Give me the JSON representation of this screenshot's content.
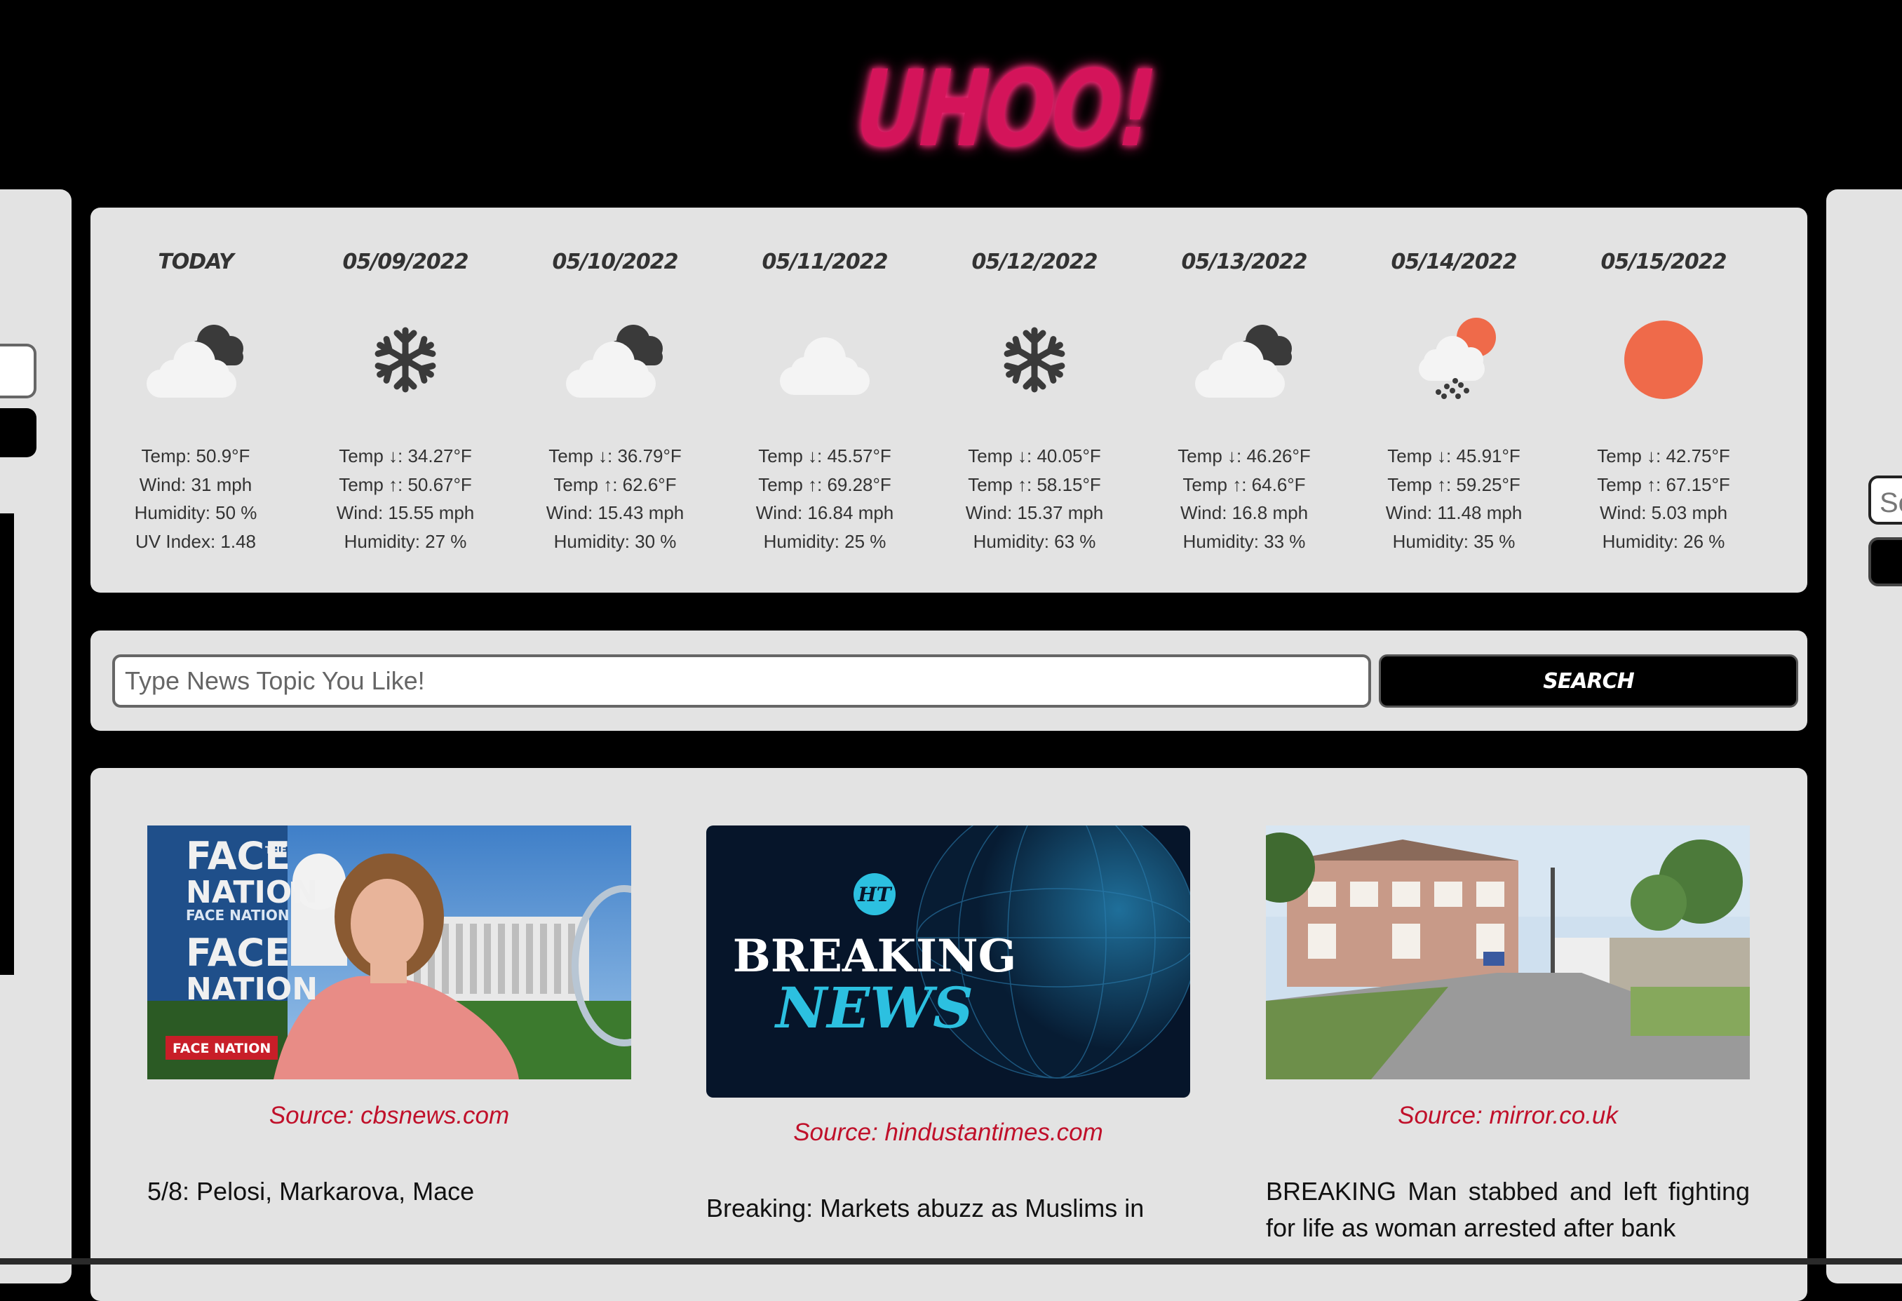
{
  "app": {
    "logo": "UHOO!"
  },
  "weather": {
    "days": [
      {
        "title": "TODAY",
        "icon": "partly-cloudy-icon",
        "lines": [
          "Temp: 50.9°F",
          "Wind: 31 mph",
          "Humidity: 50 %",
          "UV Index: 1.48"
        ]
      },
      {
        "title": "05/09/2022",
        "icon": "snow-icon",
        "lines": [
          "Temp ↓: 34.27°F",
          "Temp ↑: 50.67°F",
          "Wind: 15.55 mph",
          "Humidity: 27 %"
        ]
      },
      {
        "title": "05/10/2022",
        "icon": "partly-cloudy-icon",
        "lines": [
          "Temp ↓: 36.79°F",
          "Temp ↑: 62.6°F",
          "Wind: 15.43 mph",
          "Humidity: 30 %"
        ]
      },
      {
        "title": "05/11/2022",
        "icon": "cloud-icon",
        "lines": [
          "Temp ↓: 45.57°F",
          "Temp ↑: 69.28°F",
          "Wind: 16.84 mph",
          "Humidity: 25 %"
        ]
      },
      {
        "title": "05/12/2022",
        "icon": "snow-icon",
        "lines": [
          "Temp ↓: 40.05°F",
          "Temp ↑: 58.15°F",
          "Wind: 15.37 mph",
          "Humidity: 63 %"
        ]
      },
      {
        "title": "05/13/2022",
        "icon": "partly-cloudy-icon",
        "lines": [
          "Temp ↓: 46.26°F",
          "Temp ↑: 64.6°F",
          "Wind: 16.8 mph",
          "Humidity: 33 %"
        ]
      },
      {
        "title": "05/14/2022",
        "icon": "sun-rain-icon",
        "lines": [
          "Temp ↓: 45.91°F",
          "Temp ↑: 59.25°F",
          "Wind: 11.48 mph",
          "Humidity: 35 %"
        ]
      },
      {
        "title": "05/15/2022",
        "icon": "sun-icon",
        "lines": [
          "Temp ↓: 42.75°F",
          "Temp ↑: 67.15°F",
          "Wind: 5.03 mph",
          "Humidity: 26 %"
        ]
      }
    ]
  },
  "search": {
    "placeholder": "Type News Topic You Like!",
    "button_label": "SEARCH"
  },
  "side_right": {
    "search_placeholder_fragment": "Se"
  },
  "news": {
    "cards": [
      {
        "source": "Source: cbsnews.com",
        "text": "5/8: Pelosi, Markarova, Mace",
        "image": "face-the-nation-image",
        "image_text": {
          "line1": "FACE",
          "line2": "NATION",
          "line3": "FACE",
          "line4": "NATION",
          "the": "THE",
          "sub": "FACE NATION",
          "badge": "FACE NATION"
        }
      },
      {
        "source": "Source: hindustantimes.com",
        "text": "Breaking: Markets abuzz as Muslims in",
        "image": "breaking-news-image",
        "image_text": {
          "logo": "HT",
          "line1": "BREAKING",
          "line2": "NEWS"
        }
      },
      {
        "source": "Source: mirror.co.uk",
        "text": "BREAKING Man stabbed and left fighting for life as woman arrested after bank",
        "image": "street-view-image"
      }
    ]
  },
  "colors": {
    "accent": "#d4145a",
    "panel": "#e3e3e3",
    "source": "#c0102a",
    "sun": "#ef6a4a"
  }
}
